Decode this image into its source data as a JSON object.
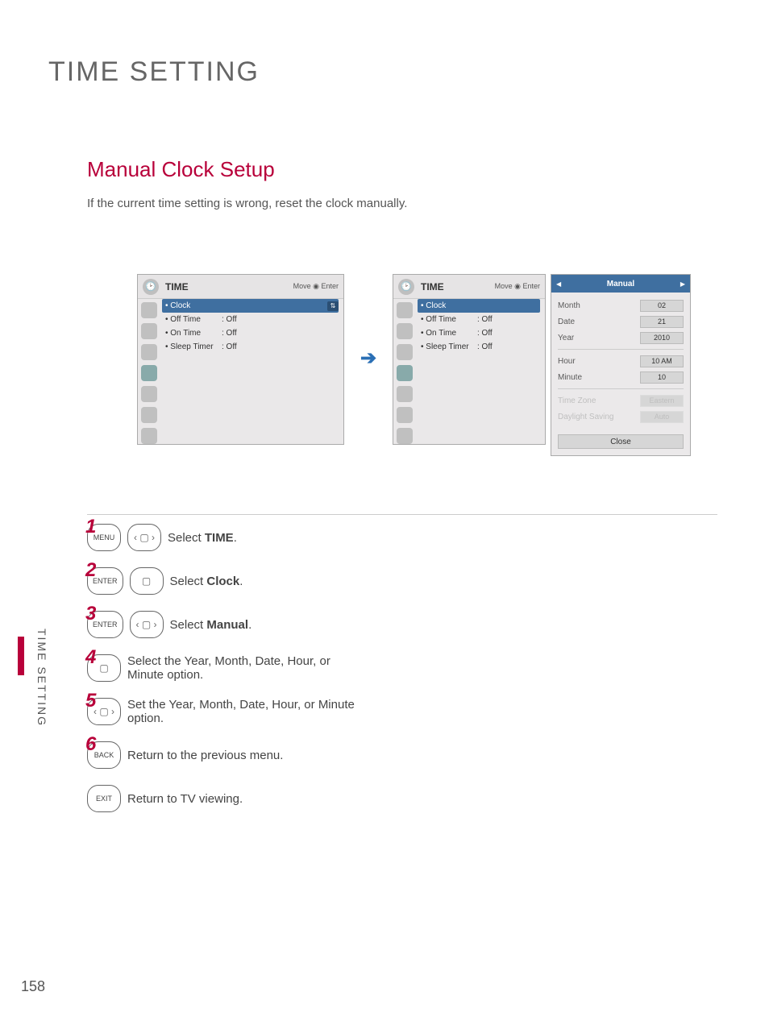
{
  "pageTitle": "TIME SETTING",
  "sectionTitle": "Manual Clock Setup",
  "introText": "If the current time setting is wrong, reset the clock manually.",
  "sideLabel": "TIME SETTING",
  "pageNumber": "158",
  "osd": {
    "title": "TIME",
    "hint": "Move   ◉ Enter",
    "headerIcon": "clock-icon",
    "items": [
      {
        "label": "Clock",
        "value": "",
        "selected": true
      },
      {
        "label": "Off Time",
        "value": ": Off",
        "selected": false
      },
      {
        "label": "On Time",
        "value": ": Off",
        "selected": false
      },
      {
        "label": "Sleep Timer",
        "value": ": Off",
        "selected": false
      }
    ]
  },
  "popup": {
    "title": "Manual",
    "rows": [
      {
        "label": "Month",
        "value": "02"
      },
      {
        "label": "Date",
        "value": "21"
      },
      {
        "label": "Year",
        "value": "2010"
      }
    ],
    "rows2": [
      {
        "label": "Hour",
        "value": "10 AM"
      },
      {
        "label": "Minute",
        "value": "10"
      }
    ],
    "rowsDisabled": [
      {
        "label": "Time Zone",
        "value": "Eastern"
      },
      {
        "label": "Daylight Saving",
        "value": "Auto"
      }
    ],
    "close": "Close"
  },
  "steps": [
    {
      "num": "1",
      "btn": "MENU",
      "dpad": "lr",
      "textPre": "Select ",
      "bold": "TIME",
      "textPost": "."
    },
    {
      "num": "2",
      "btn": "ENTER",
      "dpad": "ud",
      "textPre": "Select ",
      "bold": "Clock",
      "textPost": "."
    },
    {
      "num": "3",
      "btn": "ENTER",
      "dpad": "lr",
      "textPre": "Select ",
      "bold": "Manual",
      "textPost": "."
    },
    {
      "num": "4",
      "btn": "",
      "dpad": "ud",
      "textPre": "Select the Year, Month, Date, Hour, or Minute option.",
      "bold": "",
      "textPost": ""
    },
    {
      "num": "5",
      "btn": "",
      "dpad": "lr",
      "textPre": "Set the Year, Month, Date, Hour, or Minute option.",
      "bold": "",
      "textPost": ""
    },
    {
      "num": "6",
      "btn": "BACK",
      "dpad": "",
      "textPre": "Return to the previous menu.",
      "bold": "",
      "textPost": ""
    },
    {
      "num": "",
      "btn": "EXIT",
      "dpad": "",
      "textPre": "Return to TV viewing.",
      "bold": "",
      "textPost": ""
    }
  ]
}
